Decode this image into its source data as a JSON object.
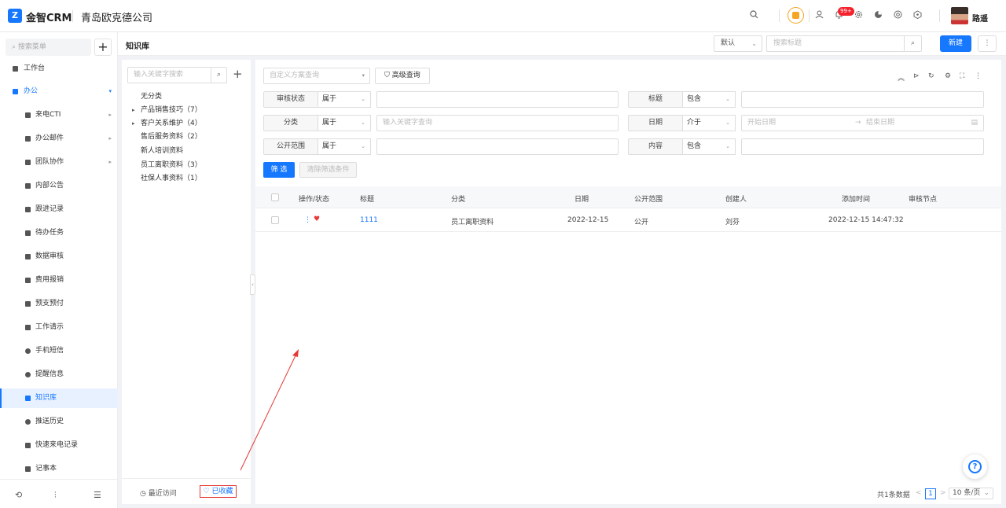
{
  "topbar": {
    "logo_mark": "Z",
    "app_name": "金智CRM",
    "company": "青岛欧克德公司",
    "notification_badge": "99+",
    "username": "路遥"
  },
  "sidebar": {
    "search_placeholder": "搜索菜单",
    "add_label": "+",
    "items": [
      {
        "label": "工作台"
      },
      {
        "label": "办公"
      },
      {
        "label": "来电CTI"
      },
      {
        "label": "办公邮件"
      },
      {
        "label": "团队协作"
      },
      {
        "label": "内部公告"
      },
      {
        "label": "跟进记录"
      },
      {
        "label": "待办任务"
      },
      {
        "label": "数据审核"
      },
      {
        "label": "费用报销"
      },
      {
        "label": "预支预付"
      },
      {
        "label": "工作请示"
      },
      {
        "label": "手机短信"
      },
      {
        "label": "提醒信息"
      },
      {
        "label": "知识库"
      },
      {
        "label": "推送历史"
      },
      {
        "label": "快速来电记录"
      },
      {
        "label": "记事本"
      }
    ]
  },
  "header": {
    "title": "知识库",
    "sort_select": "默认",
    "search_placeholder": "搜索标题",
    "new_button": "新建"
  },
  "left_panel": {
    "keyword_placeholder": "输入关键字搜索",
    "categories": [
      {
        "label": "无分类"
      },
      {
        "label": "产品销售技巧（7）"
      },
      {
        "label": "客户关系维护（4）"
      },
      {
        "label": "售后服务资料（2）"
      },
      {
        "label": "新人培训资料"
      },
      {
        "label": "员工离职资料（3）"
      },
      {
        "label": "社保人事资料（1）"
      }
    ],
    "recent_label": "最近访问",
    "favorites_label": "已收藏"
  },
  "filters": {
    "scheme_placeholder": "自定义方案查询",
    "advanced_button": "高级查询",
    "rows": [
      {
        "label": "审核状态",
        "op": "属于",
        "value": ""
      },
      {
        "label": "标题",
        "op": "包含",
        "value": ""
      },
      {
        "label": "分类",
        "op": "属于",
        "value": "输入关键字查询"
      },
      {
        "label": "日期",
        "op": "介于",
        "start": "开始日期",
        "arrow": "→",
        "end": "结束日期"
      },
      {
        "label": "公开范围",
        "op": "属于",
        "value": ""
      },
      {
        "label": "内容",
        "op": "包含",
        "value": ""
      }
    ],
    "filter_button": "筛 选",
    "clear_button": "清除筛选条件"
  },
  "table": {
    "columns": [
      "操作/状态",
      "标题",
      "分类",
      "日期",
      "公开范围",
      "创建人",
      "添加时间",
      "审核节点"
    ],
    "rows": [
      {
        "title": "1111",
        "category": "员工离职资料",
        "date": "2022-12-15",
        "scope": "公开",
        "creator": "刘芬",
        "added": "2022-12-15 14:47:32",
        "node": ""
      }
    ]
  },
  "pagination": {
    "total": "共1条数据",
    "prev": "<",
    "page": "1",
    "next": ">",
    "page_size": "10 条/页"
  },
  "help": {
    "label": "?"
  }
}
